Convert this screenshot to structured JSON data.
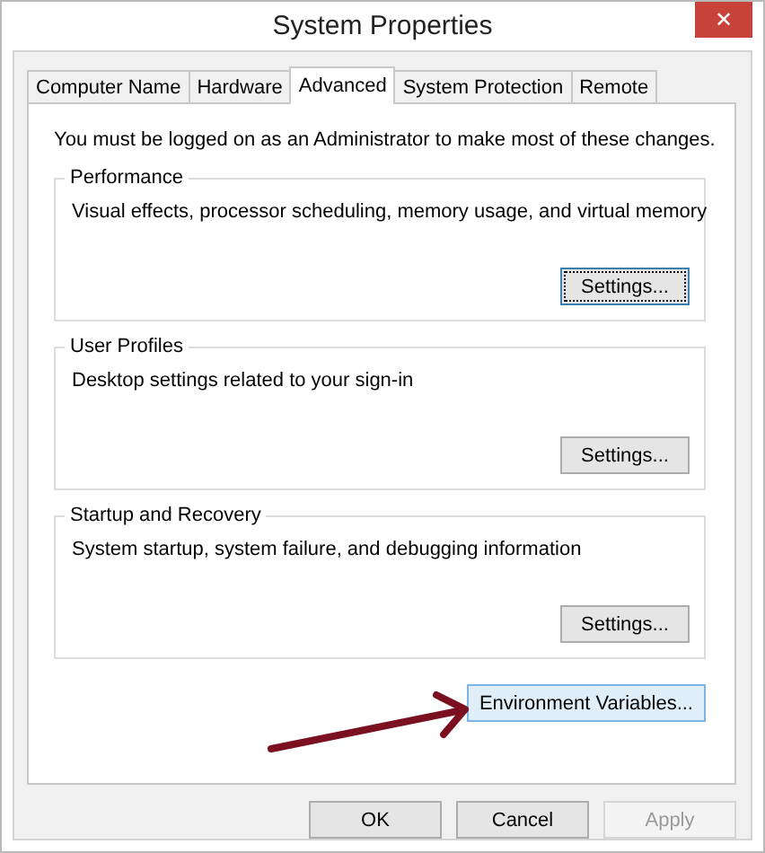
{
  "window": {
    "title": "System Properties",
    "close": "✕"
  },
  "tabs": [
    {
      "label": "Computer Name",
      "selected": false
    },
    {
      "label": "Hardware",
      "selected": false
    },
    {
      "label": "Advanced",
      "selected": true
    },
    {
      "label": "System Protection",
      "selected": false
    },
    {
      "label": "Remote",
      "selected": false
    }
  ],
  "notice": "You must be logged on as an Administrator to make most of these changes.",
  "groups": [
    {
      "title": "Performance",
      "description": "Visual effects, processor scheduling, memory usage, and virtual memory",
      "button": {
        "label": "Settings...",
        "focused": true
      }
    },
    {
      "title": "User Profiles",
      "description": "Desktop settings related to your sign-in",
      "button": {
        "label": "Settings...",
        "focused": false
      }
    },
    {
      "title": "Startup and Recovery",
      "description": "System startup, system failure, and debugging information",
      "button": {
        "label": "Settings...",
        "focused": false
      }
    }
  ],
  "environment_button": {
    "label": "Environment Variables...",
    "hovered": true
  },
  "buttons": [
    {
      "label": "OK",
      "disabled": false
    },
    {
      "label": "Cancel",
      "disabled": false
    },
    {
      "label": "Apply",
      "disabled": true
    }
  ]
}
